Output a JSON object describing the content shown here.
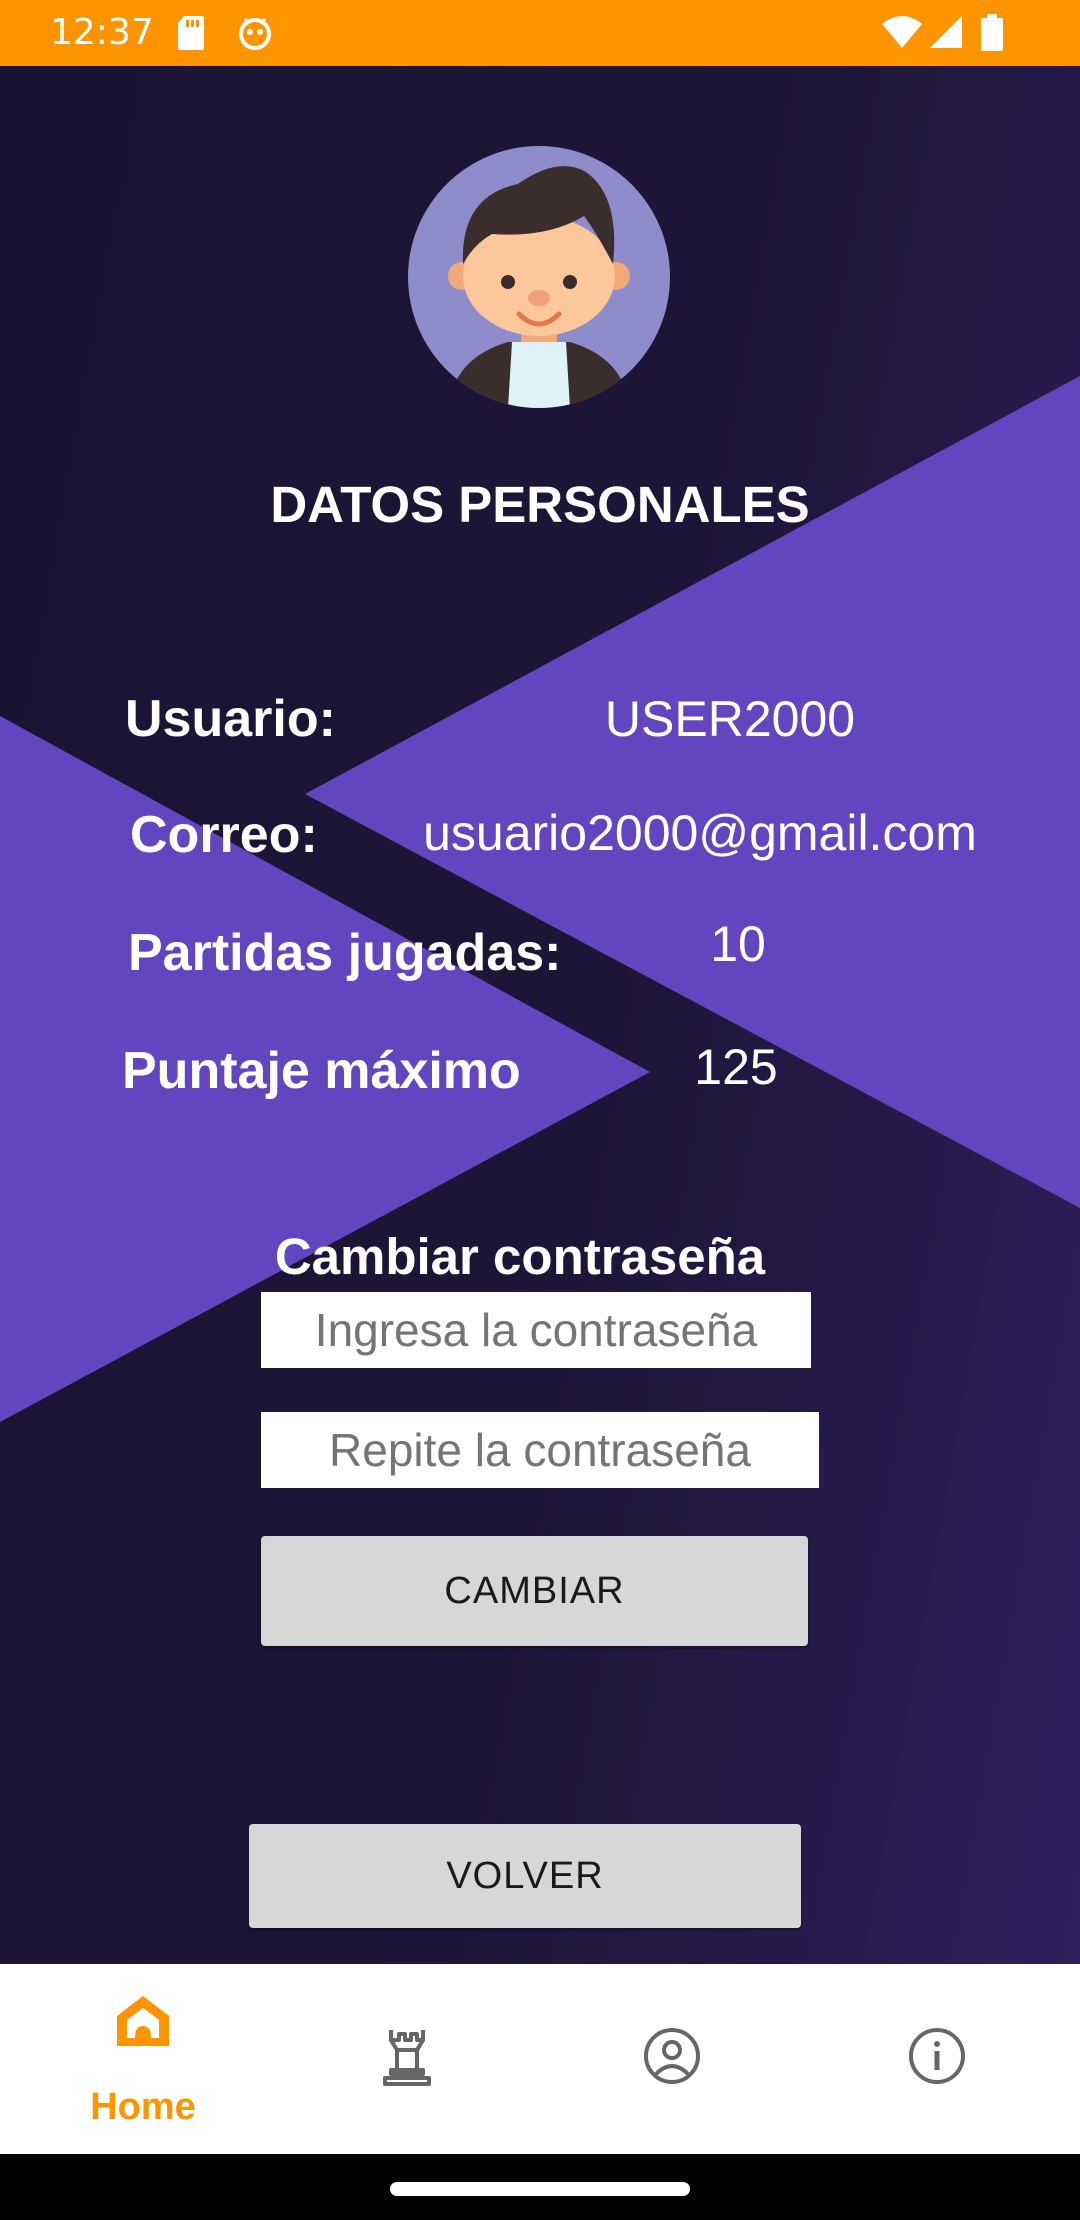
{
  "status_bar": {
    "time": "12:37",
    "icons": [
      "sd-card-icon",
      "android-debug-icon",
      "wifi-icon",
      "signal-icon",
      "battery-icon"
    ]
  },
  "profile": {
    "avatar": "avatar-boy-icon",
    "title": "DATOS PERSONALES",
    "fields": [
      {
        "label": "Usuario:",
        "value": "USER2000"
      },
      {
        "label": "Correo:",
        "value": "usuario2000@gmail.com"
      },
      {
        "label": "Partidas jugadas:",
        "value": "10"
      },
      {
        "label": "Puntaje máximo",
        "value": "125"
      }
    ]
  },
  "change_password": {
    "title": "Cambiar contraseña",
    "password_placeholder": "Ingresa la contraseña",
    "password_value": "",
    "repeat_placeholder": "Repite la contraseña",
    "repeat_value": "",
    "submit_label": "CAMBIAR"
  },
  "back_button_label": "VOLVER",
  "bottom_nav": {
    "items": [
      {
        "icon": "home-icon",
        "label": "Home",
        "active": true
      },
      {
        "icon": "chess-rook-icon",
        "label": "",
        "active": false
      },
      {
        "icon": "account-circle-icon",
        "label": "",
        "active": false
      },
      {
        "icon": "info-icon",
        "label": "",
        "active": false
      }
    ]
  },
  "colors": {
    "status_bar": "#fe9400",
    "background_dark": "#1d1537",
    "background_accent": "#6146bf",
    "button": "#d6d7d7",
    "nav_active": "#fe9400",
    "nav_inactive": "#666666"
  }
}
